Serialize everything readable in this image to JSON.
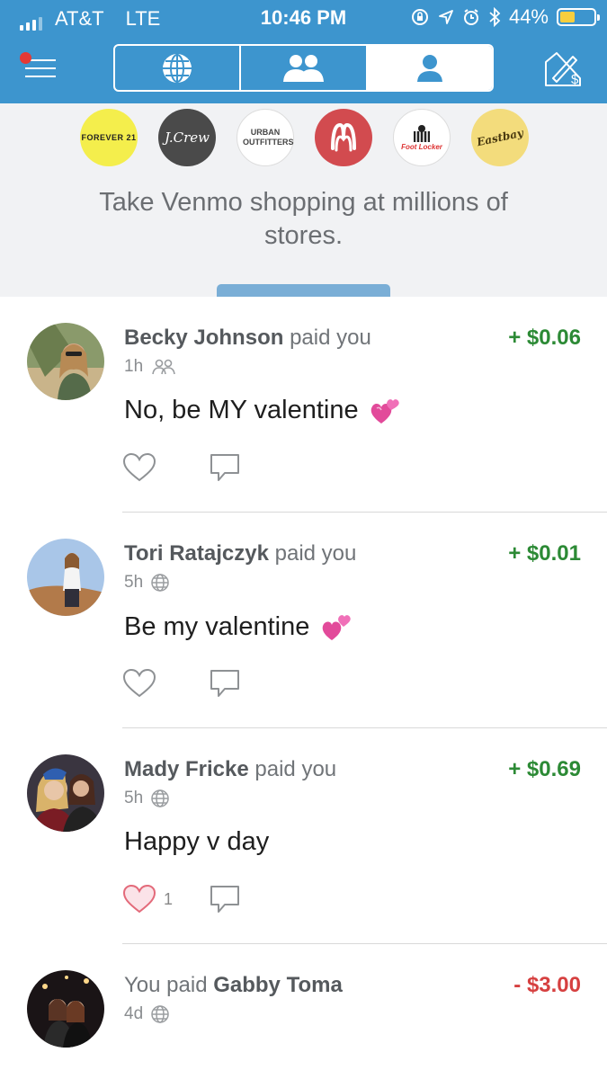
{
  "status_bar": {
    "carrier": "AT&T",
    "network": "LTE",
    "time": "10:46 PM",
    "battery_text": "44%",
    "battery_level": 0.44,
    "battery_color": "#f7ce3e"
  },
  "nav": {
    "menu_has_notification": true,
    "tabs": [
      {
        "icon": "globe-icon",
        "selected": false
      },
      {
        "icon": "friends-icon",
        "selected": false
      },
      {
        "icon": "person-icon",
        "selected": true
      }
    ],
    "pay_icon": "pay-request-icon",
    "accent_color": "#3d95ce"
  },
  "banner": {
    "logos": [
      {
        "name": "forever21",
        "text": "FOREVER 21"
      },
      {
        "name": "jcrew",
        "text": "J.Crew"
      },
      {
        "name": "urban-outfitters",
        "text": "URBAN OUTFITTERS"
      },
      {
        "name": "lululemon",
        "text": ""
      },
      {
        "name": "foot-locker",
        "text": "Foot Locker"
      },
      {
        "name": "eastbay",
        "text": "Eastbay"
      }
    ],
    "text": "Take Venmo shopping at millions of stores."
  },
  "feed": {
    "stories": [
      {
        "actor": "Becky Johnson",
        "verb": "paid you",
        "amount": "+ $0.06",
        "time": "1h",
        "audience_icon": "friends-icon",
        "note": "No, be MY valentine",
        "emoji": "💞",
        "likes": "",
        "liked": false
      },
      {
        "actor": "Tori Ratajczyk",
        "verb": "paid you",
        "amount": "+ $0.01",
        "time": "5h",
        "audience_icon": "globe-icon",
        "note": "Be my valentine",
        "emoji": "💕",
        "likes": "",
        "liked": false
      },
      {
        "actor": "Mady Fricke",
        "verb": "paid you",
        "amount": "+ $0.69",
        "time": "5h",
        "audience_icon": "globe-icon",
        "note": "Happy v day",
        "emoji": "",
        "likes": "1",
        "liked": true
      },
      {
        "prefix": "You paid",
        "target": "Gabby Toma",
        "amount": "- $3.00",
        "time": "4d",
        "audience_icon": "globe-icon",
        "note_icons": [
          "dumpling-icon",
          "fries-icon"
        ]
      }
    ],
    "colors": {
      "positive": "#2c8a35",
      "negative": "#d64040",
      "liked": "#e36a7a"
    }
  }
}
